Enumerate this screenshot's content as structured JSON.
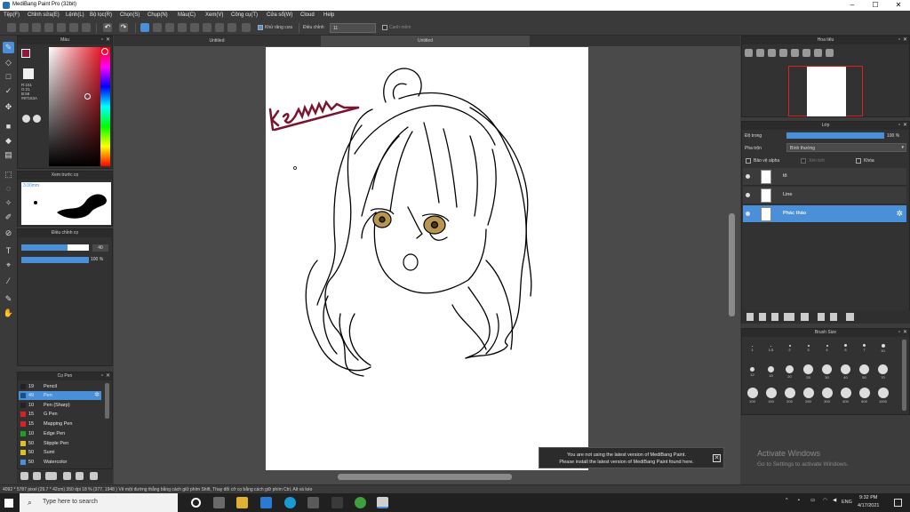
{
  "window": {
    "title": "MediBang Paint Pro (32bit)",
    "minimize": "–",
    "maximize": "☐",
    "close": "✕"
  },
  "menu": [
    "Tệp(F)",
    "Chỉnh sửa(E)",
    "Lệnh(L)",
    "Bộ lọc(R)",
    "Chọn(S)",
    "Chụp(N)",
    "Màu(C)",
    "Xem(V)",
    "Công cụ(T)",
    "Cửa sổ(W)",
    "Cloud",
    "Help"
  ],
  "toolbar": {
    "antialias_label": "Khử răng cưa",
    "correction_label": "Điều chỉnh",
    "correction_value": "11",
    "snap_label": "Canh mềm"
  },
  "tabs": [
    "Untitled",
    "Untitled"
  ],
  "color_panel": {
    "title": "Màu",
    "r": "R:151",
    "g": "G:21",
    "b": "B:58",
    "hex": "#97153A"
  },
  "brush_preview": {
    "title": "Xem trước cọ",
    "size_label": "3.00mm"
  },
  "brush_settings": {
    "title": "Điều chỉnh cọ",
    "size_value": "40",
    "opacity_value": "100 %"
  },
  "brush_list": {
    "title": "Cọ Pen",
    "items": [
      {
        "size": "19",
        "name": "Pencil",
        "color": "#222222"
      },
      {
        "size": "49",
        "name": "Pen",
        "color": "#1a4f8a"
      },
      {
        "size": "10",
        "name": "Pen (Sharp)",
        "color": "#222222"
      },
      {
        "size": "15",
        "name": "G Pen",
        "color": "#e02020"
      },
      {
        "size": "15",
        "name": "Mapping Pen",
        "color": "#e02020"
      },
      {
        "size": "10",
        "name": "Edge Pen",
        "color": "#20a020"
      },
      {
        "size": "50",
        "name": "Stipple Pen",
        "color": "#e0c020"
      },
      {
        "size": "50",
        "name": "Sumi",
        "color": "#e0c020"
      },
      {
        "size": "50",
        "name": "Watercolor",
        "color": "#4a90d9"
      }
    ]
  },
  "navigator": {
    "title": "Hoa tiêu"
  },
  "layers": {
    "title": "Lớp",
    "opacity_label": "Độ trong",
    "opacity_value": "100 %",
    "blend_label": "Pha trộn",
    "blend_value": "Bình thường",
    "protect_alpha": "Bảo vệ alpha",
    "clipping": "Xén bớt",
    "lock": "Khóa",
    "items": [
      {
        "name": "tô"
      },
      {
        "name": "Line"
      },
      {
        "name": "Phác thảo"
      }
    ]
  },
  "brush_size": {
    "title": "Brush Size",
    "rows": [
      [
        "1",
        "1.5",
        "2",
        "3",
        "4",
        "5",
        "7",
        "10"
      ],
      [
        "12",
        "15",
        "20",
        "25",
        "30",
        "40",
        "50",
        "70"
      ],
      [
        "100",
        "150",
        "200",
        "250",
        "300",
        "400",
        "500",
        "1000"
      ]
    ]
  },
  "notification": {
    "line1": "You are not using the latest version of MediBang Paint.",
    "line2": "Please install the latest version of MediBang Paint found here."
  },
  "watermark": {
    "line1": "Activate Windows",
    "line2": "Go to Settings to activate Windows."
  },
  "statusbar": {
    "text": "4092 * 5787 pixel  (29.7 * 42cm)  350 dpi  18 %  (377, 1948 )  Vẽ một đường thẳng bằng cách giữ phím Shift, Thay đổi cỡ cọ bằng cách giữ phím Ctrl, Alt và kéo"
  },
  "taskbar": {
    "search_placeholder": "Type here to search",
    "lang": "ENG",
    "time": "9:32 PM",
    "date": "4/17/2021"
  },
  "canvas": {
    "signature": "kem"
  }
}
